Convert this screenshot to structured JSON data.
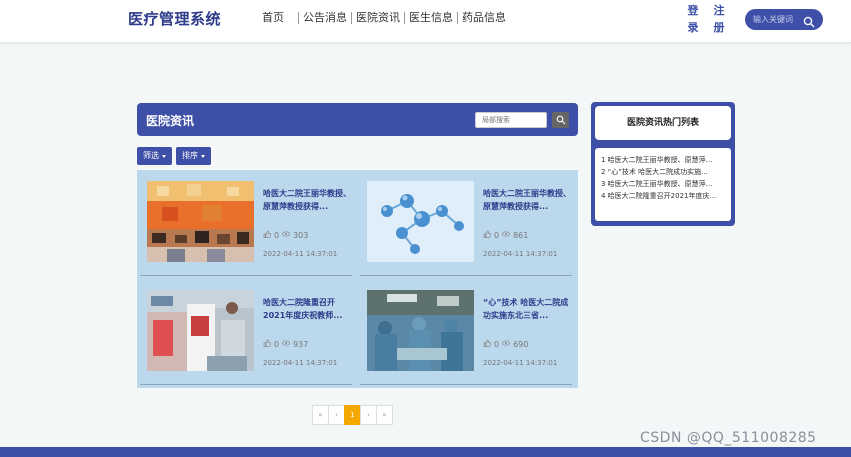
{
  "header": {
    "brand": "医疗管理系统",
    "nav": [
      "首页",
      "公告消息",
      "医院资讯",
      "医生信息",
      "药品信息"
    ],
    "login": [
      "登",
      "录"
    ],
    "register": [
      "注",
      "册"
    ],
    "search_placeholder": "输入关键词"
  },
  "panel": {
    "title": "医院资讯",
    "local_search_placeholder": "局部搜索",
    "filter_label": "筛选",
    "sort_label": "排序"
  },
  "articles": [
    {
      "title": "哈医大二院王丽华教授、原慧萍教授获得...",
      "likes": "0",
      "views": "303",
      "date": "2022-04-11 14:37:01"
    },
    {
      "title": "哈医大二院王丽华教授、原慧萍教授获得...",
      "likes": "0",
      "views": "861",
      "date": "2022-04-11 14:37:01"
    },
    {
      "title": "哈医大二院隆重召开2021年度庆祝教师...",
      "likes": "0",
      "views": "937",
      "date": "2022-04-11 14:37:01"
    },
    {
      "title": "“心”技术 哈医大二院成功实施东北三省...",
      "likes": "0",
      "views": "690",
      "date": "2022-04-11 14:37:01"
    }
  ],
  "pagination": {
    "first": "«",
    "prev": "‹",
    "current": "1",
    "next": "›",
    "last": "»"
  },
  "hot": {
    "title": "医院资讯热门列表",
    "items": [
      "1 哈医大二院王丽华教授、原慧萍...",
      "2 “心”技术 哈医大二院成功实施...",
      "3 哈医大二院王丽华教授、原慧萍...",
      "4 哈医大二院隆重召开2021年度庆..."
    ]
  },
  "watermark": "CSDN @QQ_511008285",
  "colors": {
    "primary": "#3d4fa6",
    "grid_bg": "#bcd8ed",
    "page_active": "#f5a800"
  }
}
